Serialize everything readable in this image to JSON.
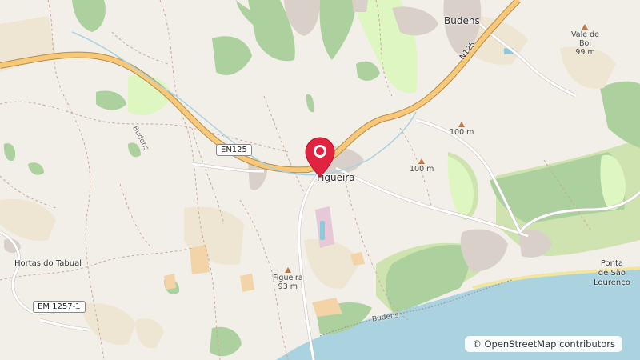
{
  "map": {
    "places": {
      "budens_town": "Budens",
      "figueira_town": "Figueira",
      "hortas": "Hortas do Tabual",
      "ponta_line1": "Ponta",
      "ponta_line2": "de São",
      "ponta_line3": "Lourenço",
      "budens_street": "Budens",
      "budens_coast": "Budens"
    },
    "peaks": {
      "vale_line1": "Vale de",
      "vale_line2": "Boi",
      "vale_elev": "99 m",
      "peak_100a": "100 m",
      "peak_100b": "100 m",
      "figueira_name": "Figueira",
      "figueira_elev": "93 m"
    },
    "roads": {
      "en125": "EN125",
      "n125": "N125",
      "em1257": "EM 1257-1"
    },
    "marker": {
      "icon": "map-pin-icon",
      "color": "#e0233f"
    },
    "attribution": "© OpenStreetMap contributors",
    "colors": {
      "land": "#f2efe9",
      "forest": "#add19e",
      "sea": "#aad3df",
      "motorway": "#f7c878",
      "farmland": "#eee6d2"
    }
  }
}
